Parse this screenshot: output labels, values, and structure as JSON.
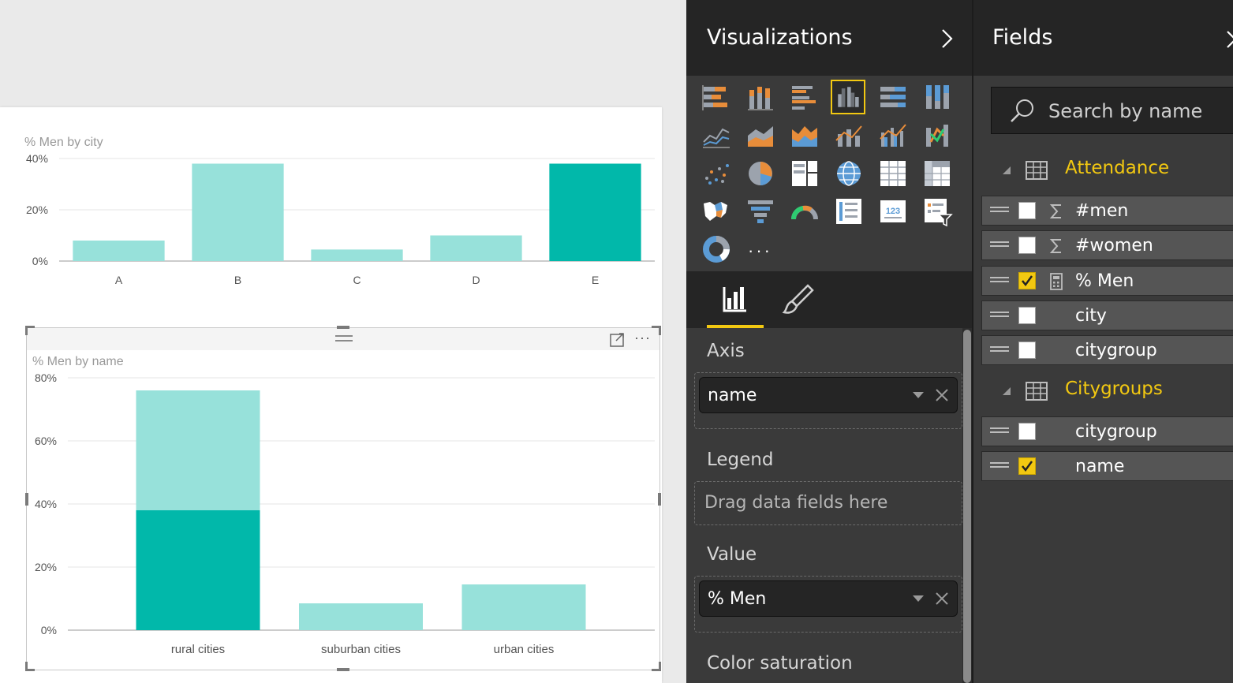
{
  "chart1": {
    "title": "% Men by city",
    "y_ticks": [
      "40%",
      "20%",
      "0%"
    ],
    "colors": {
      "light": "#97e1da",
      "dark": "#01b8aa"
    },
    "chart_data": {
      "type": "bar",
      "title": "% Men by city",
      "categories": [
        "A",
        "B",
        "C",
        "D",
        "E"
      ],
      "values": [
        8,
        38,
        4.5,
        10,
        38
      ],
      "highlighted": [
        false,
        false,
        false,
        false,
        true
      ],
      "ylim": [
        0,
        40
      ],
      "grid": true
    }
  },
  "chart2": {
    "title": "% Men by name",
    "y_ticks": [
      "80%",
      "60%",
      "40%",
      "20%",
      "0%"
    ],
    "colors": {
      "light": "#97e1da",
      "dark": "#01b8aa"
    },
    "chart_data": {
      "type": "bar",
      "title": "% Men by name",
      "categories": [
        "rural cities",
        "suburban cities",
        "urban cities"
      ],
      "values": [
        76,
        8.5,
        14.5
      ],
      "highlight_values": [
        38,
        0,
        0
      ],
      "ylim": [
        0,
        80
      ],
      "grid": true
    }
  },
  "visualizations": {
    "title": "Visualizations",
    "gallery_icons": [
      "stacked-bar-chart-icon",
      "stacked-column-chart-icon",
      "clustered-bar-chart-icon",
      "clustered-column-chart-icon",
      "100-stacked-bar-chart-icon",
      "100-stacked-column-chart-icon",
      "line-chart-icon",
      "area-chart-icon",
      "stacked-area-chart-icon",
      "line-and-stacked-column-chart-icon",
      "line-and-clustered-column-chart-icon",
      "ribbon-chart-icon",
      "scatter-chart-icon",
      "pie-chart-icon",
      "treemap-icon",
      "map-icon",
      "table-icon",
      "matrix-icon",
      "filled-map-icon",
      "funnel-icon",
      "gauge-icon",
      "multi-row-card-icon",
      "card-icon",
      "slicer-icon",
      "donut-chart-icon"
    ],
    "selected_icon": "clustered-column-chart-icon",
    "more_label": "···",
    "tabs": [
      "fields-tab-icon",
      "format-paintbrush-icon"
    ],
    "axis_label": "Axis",
    "axis_value": "name",
    "legend_label": "Legend",
    "legend_placeholder": "Drag data fields here",
    "value_label": "Value",
    "value_value": "% Men",
    "color_saturation_label": "Color saturation"
  },
  "fields": {
    "title": "Fields",
    "search_placeholder": "Search by name",
    "tables": [
      {
        "name": "Attendance",
        "fields": [
          {
            "name": "#men",
            "icon": "sigma-icon",
            "checked": false
          },
          {
            "name": "#women",
            "icon": "sigma-icon",
            "checked": false
          },
          {
            "name": "% Men",
            "icon": "calculator-icon",
            "checked": true
          },
          {
            "name": "city",
            "icon": "",
            "checked": false
          },
          {
            "name": "citygroup",
            "icon": "",
            "checked": false
          }
        ]
      },
      {
        "name": "Citygroups",
        "fields": [
          {
            "name": "citygroup",
            "icon": "",
            "checked": false
          },
          {
            "name": "name",
            "icon": "",
            "checked": true
          }
        ]
      }
    ],
    "accent_color": "#f2c811"
  }
}
